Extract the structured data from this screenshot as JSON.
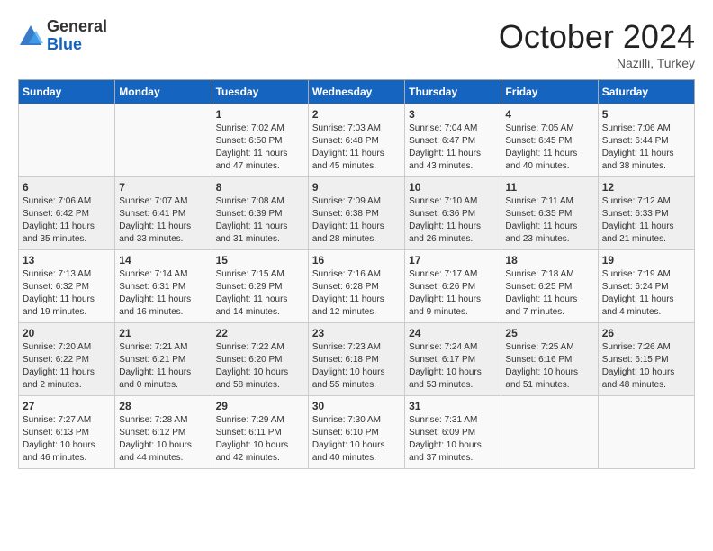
{
  "header": {
    "logo_general": "General",
    "logo_blue": "Blue",
    "month_title": "October 2024",
    "location": "Nazilli, Turkey"
  },
  "days_of_week": [
    "Sunday",
    "Monday",
    "Tuesday",
    "Wednesday",
    "Thursday",
    "Friday",
    "Saturday"
  ],
  "weeks": [
    [
      {
        "day": "",
        "sunrise": "",
        "sunset": "",
        "daylight": ""
      },
      {
        "day": "",
        "sunrise": "",
        "sunset": "",
        "daylight": ""
      },
      {
        "day": "1",
        "sunrise": "Sunrise: 7:02 AM",
        "sunset": "Sunset: 6:50 PM",
        "daylight": "Daylight: 11 hours and 47 minutes."
      },
      {
        "day": "2",
        "sunrise": "Sunrise: 7:03 AM",
        "sunset": "Sunset: 6:48 PM",
        "daylight": "Daylight: 11 hours and 45 minutes."
      },
      {
        "day": "3",
        "sunrise": "Sunrise: 7:04 AM",
        "sunset": "Sunset: 6:47 PM",
        "daylight": "Daylight: 11 hours and 43 minutes."
      },
      {
        "day": "4",
        "sunrise": "Sunrise: 7:05 AM",
        "sunset": "Sunset: 6:45 PM",
        "daylight": "Daylight: 11 hours and 40 minutes."
      },
      {
        "day": "5",
        "sunrise": "Sunrise: 7:06 AM",
        "sunset": "Sunset: 6:44 PM",
        "daylight": "Daylight: 11 hours and 38 minutes."
      }
    ],
    [
      {
        "day": "6",
        "sunrise": "Sunrise: 7:06 AM",
        "sunset": "Sunset: 6:42 PM",
        "daylight": "Daylight: 11 hours and 35 minutes."
      },
      {
        "day": "7",
        "sunrise": "Sunrise: 7:07 AM",
        "sunset": "Sunset: 6:41 PM",
        "daylight": "Daylight: 11 hours and 33 minutes."
      },
      {
        "day": "8",
        "sunrise": "Sunrise: 7:08 AM",
        "sunset": "Sunset: 6:39 PM",
        "daylight": "Daylight: 11 hours and 31 minutes."
      },
      {
        "day": "9",
        "sunrise": "Sunrise: 7:09 AM",
        "sunset": "Sunset: 6:38 PM",
        "daylight": "Daylight: 11 hours and 28 minutes."
      },
      {
        "day": "10",
        "sunrise": "Sunrise: 7:10 AM",
        "sunset": "Sunset: 6:36 PM",
        "daylight": "Daylight: 11 hours and 26 minutes."
      },
      {
        "day": "11",
        "sunrise": "Sunrise: 7:11 AM",
        "sunset": "Sunset: 6:35 PM",
        "daylight": "Daylight: 11 hours and 23 minutes."
      },
      {
        "day": "12",
        "sunrise": "Sunrise: 7:12 AM",
        "sunset": "Sunset: 6:33 PM",
        "daylight": "Daylight: 11 hours and 21 minutes."
      }
    ],
    [
      {
        "day": "13",
        "sunrise": "Sunrise: 7:13 AM",
        "sunset": "Sunset: 6:32 PM",
        "daylight": "Daylight: 11 hours and 19 minutes."
      },
      {
        "day": "14",
        "sunrise": "Sunrise: 7:14 AM",
        "sunset": "Sunset: 6:31 PM",
        "daylight": "Daylight: 11 hours and 16 minutes."
      },
      {
        "day": "15",
        "sunrise": "Sunrise: 7:15 AM",
        "sunset": "Sunset: 6:29 PM",
        "daylight": "Daylight: 11 hours and 14 minutes."
      },
      {
        "day": "16",
        "sunrise": "Sunrise: 7:16 AM",
        "sunset": "Sunset: 6:28 PM",
        "daylight": "Daylight: 11 hours and 12 minutes."
      },
      {
        "day": "17",
        "sunrise": "Sunrise: 7:17 AM",
        "sunset": "Sunset: 6:26 PM",
        "daylight": "Daylight: 11 hours and 9 minutes."
      },
      {
        "day": "18",
        "sunrise": "Sunrise: 7:18 AM",
        "sunset": "Sunset: 6:25 PM",
        "daylight": "Daylight: 11 hours and 7 minutes."
      },
      {
        "day": "19",
        "sunrise": "Sunrise: 7:19 AM",
        "sunset": "Sunset: 6:24 PM",
        "daylight": "Daylight: 11 hours and 4 minutes."
      }
    ],
    [
      {
        "day": "20",
        "sunrise": "Sunrise: 7:20 AM",
        "sunset": "Sunset: 6:22 PM",
        "daylight": "Daylight: 11 hours and 2 minutes."
      },
      {
        "day": "21",
        "sunrise": "Sunrise: 7:21 AM",
        "sunset": "Sunset: 6:21 PM",
        "daylight": "Daylight: 11 hours and 0 minutes."
      },
      {
        "day": "22",
        "sunrise": "Sunrise: 7:22 AM",
        "sunset": "Sunset: 6:20 PM",
        "daylight": "Daylight: 10 hours and 58 minutes."
      },
      {
        "day": "23",
        "sunrise": "Sunrise: 7:23 AM",
        "sunset": "Sunset: 6:18 PM",
        "daylight": "Daylight: 10 hours and 55 minutes."
      },
      {
        "day": "24",
        "sunrise": "Sunrise: 7:24 AM",
        "sunset": "Sunset: 6:17 PM",
        "daylight": "Daylight: 10 hours and 53 minutes."
      },
      {
        "day": "25",
        "sunrise": "Sunrise: 7:25 AM",
        "sunset": "Sunset: 6:16 PM",
        "daylight": "Daylight: 10 hours and 51 minutes."
      },
      {
        "day": "26",
        "sunrise": "Sunrise: 7:26 AM",
        "sunset": "Sunset: 6:15 PM",
        "daylight": "Daylight: 10 hours and 48 minutes."
      }
    ],
    [
      {
        "day": "27",
        "sunrise": "Sunrise: 7:27 AM",
        "sunset": "Sunset: 6:13 PM",
        "daylight": "Daylight: 10 hours and 46 minutes."
      },
      {
        "day": "28",
        "sunrise": "Sunrise: 7:28 AM",
        "sunset": "Sunset: 6:12 PM",
        "daylight": "Daylight: 10 hours and 44 minutes."
      },
      {
        "day": "29",
        "sunrise": "Sunrise: 7:29 AM",
        "sunset": "Sunset: 6:11 PM",
        "daylight": "Daylight: 10 hours and 42 minutes."
      },
      {
        "day": "30",
        "sunrise": "Sunrise: 7:30 AM",
        "sunset": "Sunset: 6:10 PM",
        "daylight": "Daylight: 10 hours and 40 minutes."
      },
      {
        "day": "31",
        "sunrise": "Sunrise: 7:31 AM",
        "sunset": "Sunset: 6:09 PM",
        "daylight": "Daylight: 10 hours and 37 minutes."
      },
      {
        "day": "",
        "sunrise": "",
        "sunset": "",
        "daylight": ""
      },
      {
        "day": "",
        "sunrise": "",
        "sunset": "",
        "daylight": ""
      }
    ]
  ]
}
